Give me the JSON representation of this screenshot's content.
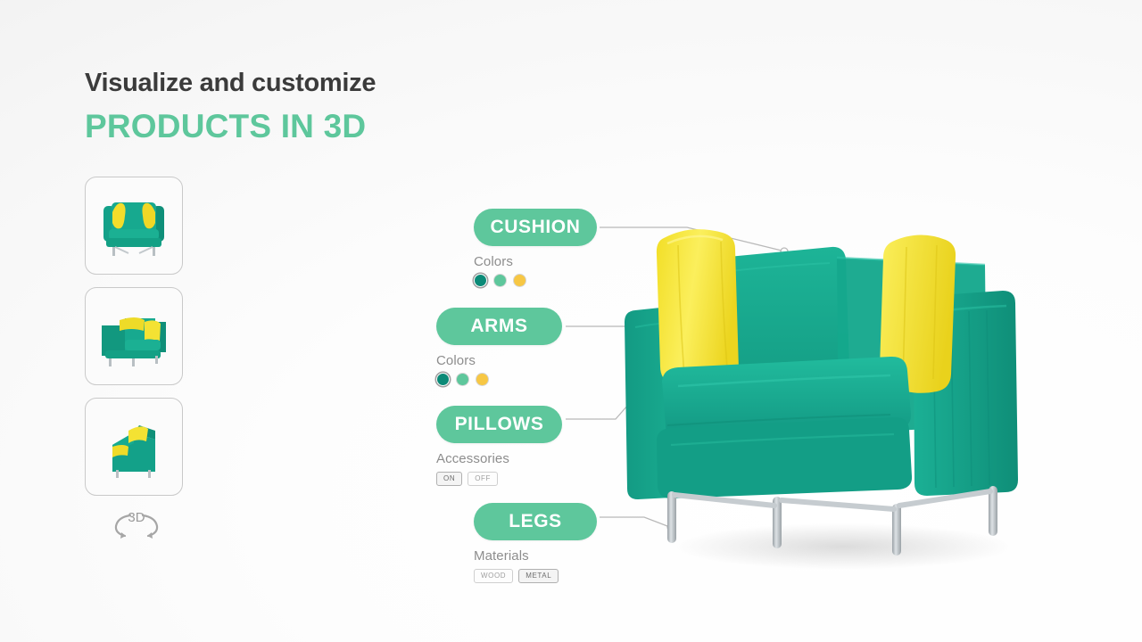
{
  "headline": {
    "line1": "Visualize and customize",
    "line2": "PRODUCTS IN 3D"
  },
  "colors": {
    "accent_green": "#5ec79c",
    "dark_teal": "#0b8a77",
    "mid_green": "#5ec79c",
    "yellow": "#f7c744",
    "heading_dark": "#3b3b3b",
    "label_gray": "#8d8d8d",
    "chair_body": "#16a085",
    "chair_pillow": "#f5e12a",
    "leg_metal": "#b5bcc0"
  },
  "thumbnails": {
    "items": [
      {
        "name": "front-view",
        "alt": "Armchair front view"
      },
      {
        "name": "three-quarter-view",
        "alt": "Armchair three quarter view"
      },
      {
        "name": "side-angle-view",
        "alt": "Armchair side angle view"
      }
    ]
  },
  "rotate_control": {
    "label": "3D",
    "icon": "rotate-3d-icon"
  },
  "callouts": [
    {
      "id": "cushion",
      "label": "CUSHION",
      "sub_label": "Colors",
      "control_type": "swatches",
      "swatches": [
        {
          "color": "#0b8a77",
          "selected": true
        },
        {
          "color": "#5ec79c",
          "selected": false
        },
        {
          "color": "#f7c744",
          "selected": false
        }
      ]
    },
    {
      "id": "arms",
      "label": "ARMS",
      "sub_label": "Colors",
      "control_type": "swatches",
      "swatches": [
        {
          "color": "#0b8a77",
          "selected": true
        },
        {
          "color": "#5ec79c",
          "selected": false
        },
        {
          "color": "#f7c744",
          "selected": false
        }
      ]
    },
    {
      "id": "pillows",
      "label": "PILLOWS",
      "sub_label": "Accessories",
      "control_type": "toggle",
      "options": [
        {
          "text": "ON",
          "selected": true
        },
        {
          "text": "OFF",
          "selected": false
        }
      ]
    },
    {
      "id": "legs",
      "label": "LEGS",
      "sub_label": "Materials",
      "control_type": "toggle",
      "options": [
        {
          "text": "WOOD",
          "selected": false
        },
        {
          "text": "METAL",
          "selected": true
        }
      ]
    }
  ]
}
